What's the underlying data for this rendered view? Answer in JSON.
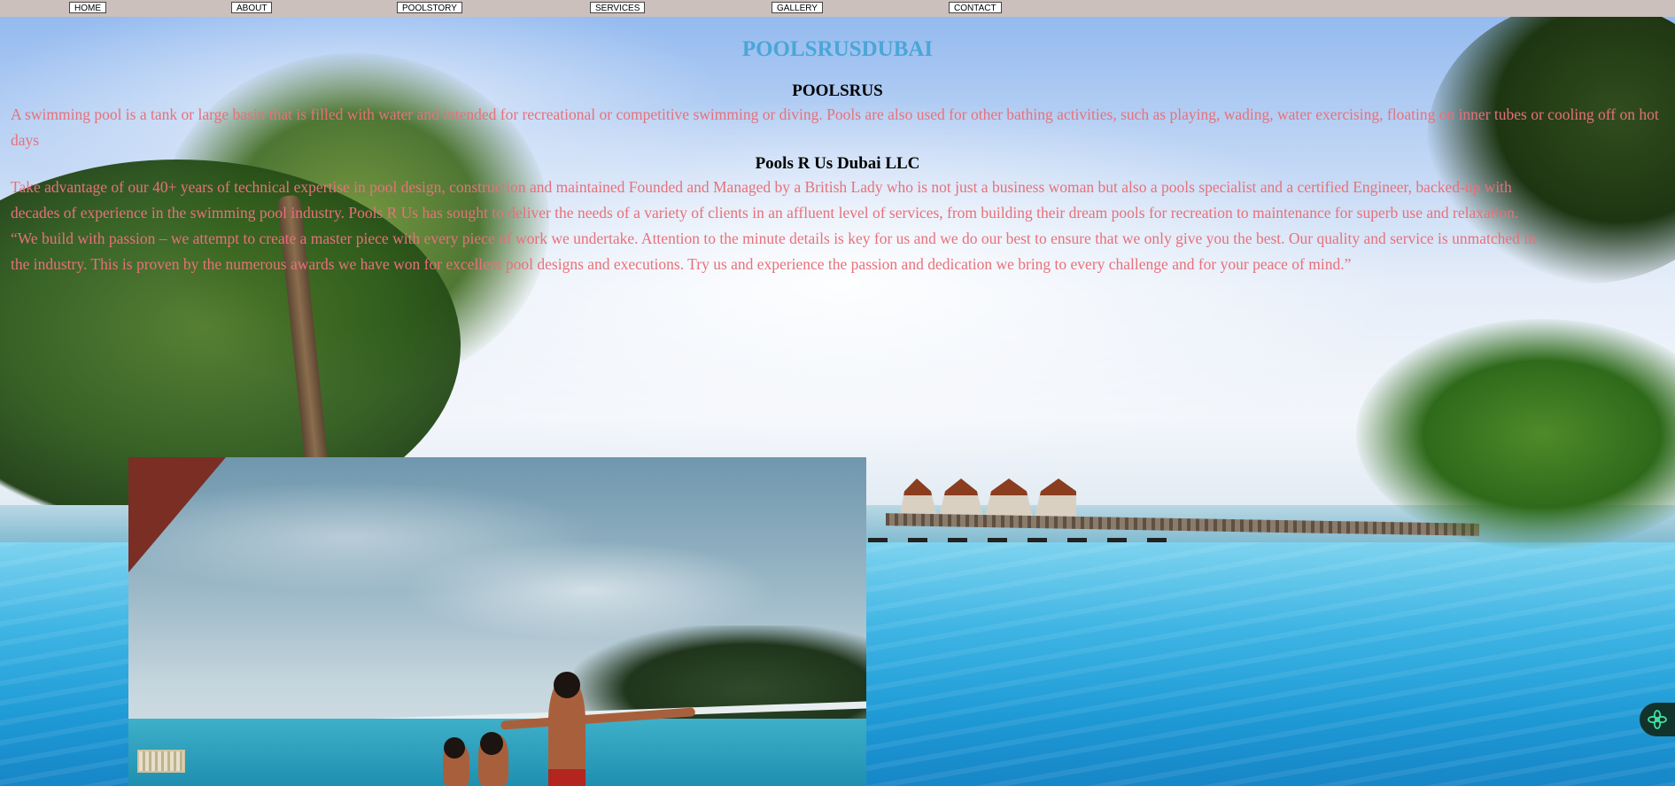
{
  "nav": {
    "home": "HOME",
    "about": "ABOUT",
    "poolstory": "POOLSTORY",
    "services": "SERVICES",
    "gallery": "GALLERY",
    "contact": "CONTACT"
  },
  "site_title": "POOLSRUSDUBAI",
  "sections": {
    "poolsrus_heading": "POOLSRUS",
    "poolsrus_text": "A swimming pool is a tank or large basin that is filled with water and intended for recreational or competitive swimming or diving. Pools are also used for other bathing activities, such as playing, wading, water exercising, floating on inner tubes or cooling off on hot days",
    "llc_heading": "Pools R Us Dubai LLC",
    "llc_line1": "Take advantage of our 40+ years of technical expertise in pool design, construction and maintained Founded and Managed by a British Lady who is not just a business woman but also a pools specialist and a certified Engineer, backed-up with",
    "llc_line2": "decades of experience in the swimming pool industry. Pools R Us has sought to deliver the needs of a variety of clients in an affluent level of services, from building their dream pools for recreation to maintenance for superb use and relaxation.",
    "llc_line3": "“We build with passion – we attempt to create a master piece with every piece of work we undertake. Attention to the minute details is key for us and we do our best to ensure that we only give you the best. Our quality and service is unmatched in",
    "llc_line4": "the industry. This is proven by the numerous awards we have won for excellent pool designs and executions. Try us and experience the passion and dedication we bring to every challenge and for your peace of mind.”"
  },
  "colors": {
    "title": "#4aa6d6",
    "body_text": "#e8707a",
    "nav_bar": "#cbc0bc",
    "widget": "#13322b",
    "widget_icon": "#3ee0a0"
  },
  "icons": {
    "widget": "chatbot-flower-icon"
  }
}
